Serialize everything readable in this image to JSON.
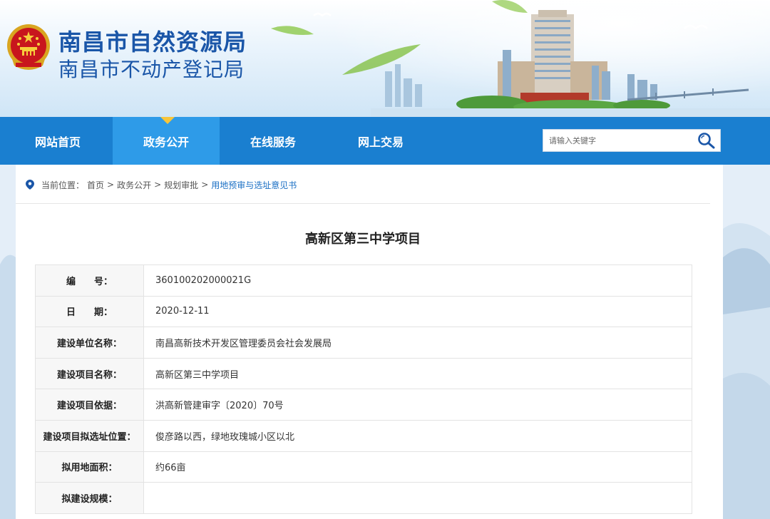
{
  "header": {
    "title_line1": "南昌市自然资源局",
    "title_line2": "南昌市不动产登记局",
    "emblem_icon": "national-emblem-icon"
  },
  "nav": {
    "items": [
      {
        "label": "网站首页"
      },
      {
        "label": "政务公开"
      },
      {
        "label": "在线服务"
      },
      {
        "label": "网上交易"
      }
    ],
    "active_index": 1,
    "search_placeholder": "请输入关键字",
    "colors": {
      "bar": "#1a7fd0",
      "active": "#2e9be8",
      "caret": "#f7c53a"
    }
  },
  "breadcrumb": {
    "prefix": "当前位置：",
    "items": [
      "首页",
      "政务公开",
      "规划审批",
      "用地预审与选址意见书"
    ],
    "separator": ">"
  },
  "article": {
    "title": "高新区第三中学项目",
    "rows": [
      {
        "label": "编　　号：",
        "value": "360100202000021G"
      },
      {
        "label": "日　　期：",
        "value": "2020-12-11"
      },
      {
        "label": "建设单位名称：",
        "value": "南昌高新技术开发区管理委员会社会发展局"
      },
      {
        "label": "建设项目名称：",
        "value": "高新区第三中学项目"
      },
      {
        "label": "建设项目依据：",
        "value": "洪高新管建审字〔2020〕70号"
      },
      {
        "label": "建设项目拟选址位置：",
        "value": "俊彦路以西，绿地玫瑰城小区以北"
      },
      {
        "label": "拟用地面积：",
        "value": "约66亩"
      },
      {
        "label": "拟建设规模：",
        "value": ""
      }
    ]
  }
}
